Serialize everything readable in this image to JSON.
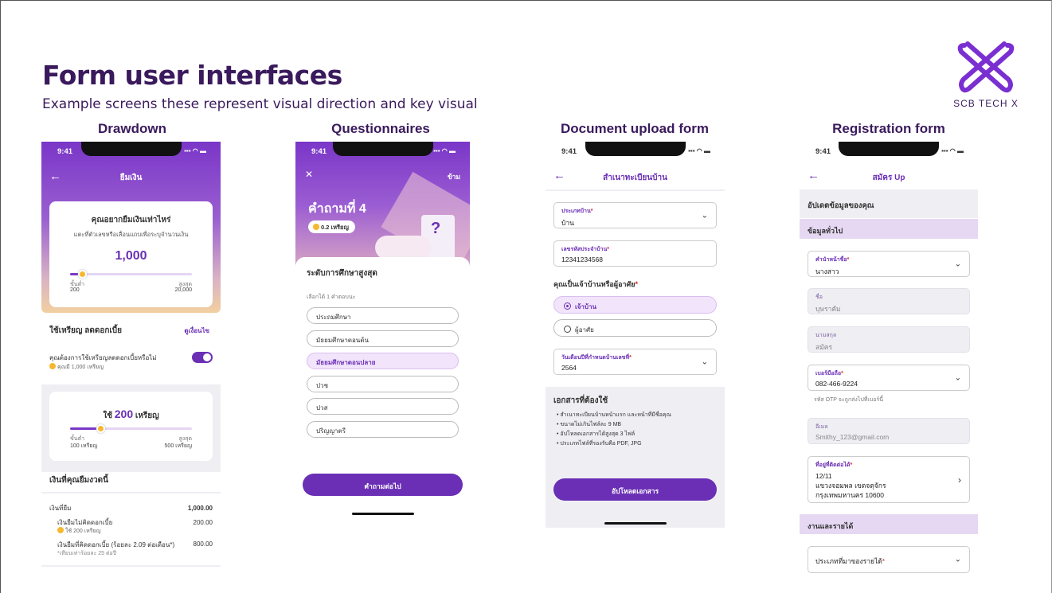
{
  "slide": {
    "title": "Form user interfaces",
    "subtitle": "Example screens these represent visual direction and key visual",
    "logo_text": "SCB TECH X",
    "brand_color": "#7a2fd1",
    "heading_color": "#3a1a5c"
  },
  "columns": {
    "drawdown": "Drawdown",
    "questionnaires": "Questionnaires",
    "upload": "Document upload form",
    "registration": "Registration form"
  },
  "status": {
    "time": "9:41",
    "icons": "▪▪▪ ◠ ▬"
  },
  "drawdown": {
    "header": "ยืมเงิน",
    "card_title": "คุณอยากยืมเงินเท่าไหร่",
    "card_hint": "แตะที่ตัวเลขหรือเลื่อนแถบเพื่อระบุจำนวนเงิน",
    "amount": "1,000",
    "amount_fraction": 0.1,
    "min_label": "ขั้นต่ำ",
    "min_value": "200",
    "max_label": "สูงสุด",
    "max_value": "20,000",
    "coin_section_title": "ใช้เหรียญ ลดดอกเบี้ย",
    "coin_section_link": "ดูเงื่อนไข",
    "coin_question": "คุณต้องการใช้เหรียญลดดอกเบี้ยหรือไม่",
    "coin_balance": "คุณมี 1,000 เหรียญ",
    "use_prefix": "ใช้",
    "use_amount": "200",
    "use_suffix": "เหรียญ",
    "coin_fraction": 0.25,
    "coin_min_value": "100 เหรียญ",
    "coin_max_value": "500 เหรียญ",
    "summary_title": "เงินที่คุณยืมงวดนี้",
    "rows": [
      {
        "label": "เงินที่ยืม",
        "value": "1,000.00",
        "sub": ""
      },
      {
        "label": "เงินยืมไม่คิดดอกเบี้ย",
        "value": "200.00",
        "sub": "ใช้ 200 เหรียญ"
      },
      {
        "label": "เงินยืมที่คิดดอกเบี้ย (ร้อยละ 2.09 ต่อเดือน*)",
        "value": "800.00",
        "sub": "*เทียบเท่าร้อยละ 25 ต่อปี"
      }
    ]
  },
  "questionnaire": {
    "close_icon": "✕",
    "skip": "ข้าม",
    "question": "คำถามที่ 4",
    "reward": "0.2 เหรียญ",
    "prompt": "ระดับการศึกษาสูงสุด",
    "hint": "เลือกได้ 1 คำตอบนะ",
    "options": [
      "ประถมศึกษา",
      "มัธยมศึกษาตอนต้น",
      "มัธยมศึกษาตอนปลาย",
      "ปวช",
      "ปวส",
      "ปริญญาตรี"
    ],
    "selected_index": 2,
    "next_button": "คำถามต่อไป"
  },
  "upload": {
    "header": "สำเนาทะเบียนบ้าน",
    "house_type_label": "ประเภทบ้าน",
    "house_type_value": "บ้าน",
    "house_no_label": "เลขรหัสประจำบ้าน",
    "house_no_value": "12341234568",
    "owner_question": "คุณเป็นเจ้าบ้านหรือผู้อาศัย",
    "owner_opt1": "เจ้าบ้าน",
    "owner_opt2": "ผู้อาศัย",
    "date_label": "วันเดือนปีที่กำหนดบ้านเลขที่",
    "date_value": "2564",
    "docs_title": "เอกสารที่ต้องใช้",
    "docs": [
      "สำเนาทะเบียนบ้านหน้าแรก และหน้าที่มีชื่อคุณ",
      "ขนาดไม่เกินไฟล์ละ 9 MB",
      "อัปโหลดเอกสารได้สูงสุด 3 ไฟล์",
      "ประเภทไฟล์ที่รองรับคือ PDF, JPG"
    ],
    "upload_button": "อัปโหลดเอกสาร"
  },
  "registration": {
    "header": "สมัคร Up",
    "update_title": "อัปเดตข้อมูลของคุณ",
    "general_section": "ข้อมูลทั่วไป",
    "prefix_label": "คำนำหน้าชื่อ",
    "prefix_value": "นางสาว",
    "name_label": "ชื่อ",
    "name_value": "บุษราคัม",
    "surname_label": "นามสกุล",
    "surname_value": "สมัคร",
    "phone_label": "เบอร์มือถือ",
    "phone_value": "082-466-9224",
    "otp_hint": "รหัส OTP จะถูกส่งไปที่เบอร์นี้",
    "email_label": "อีเมล",
    "email_value": "Smithy_123@gmail.com",
    "address_label": "ที่อยู่ที่ติดต่อได้",
    "address_lines": [
      "12/11",
      "แขวงจอมพล เขตจตุจักร",
      "กรุงเทพมหานคร 10600"
    ],
    "work_section": "งานและรายได้",
    "income_label": "ประเภทที่มาของรายได้"
  }
}
